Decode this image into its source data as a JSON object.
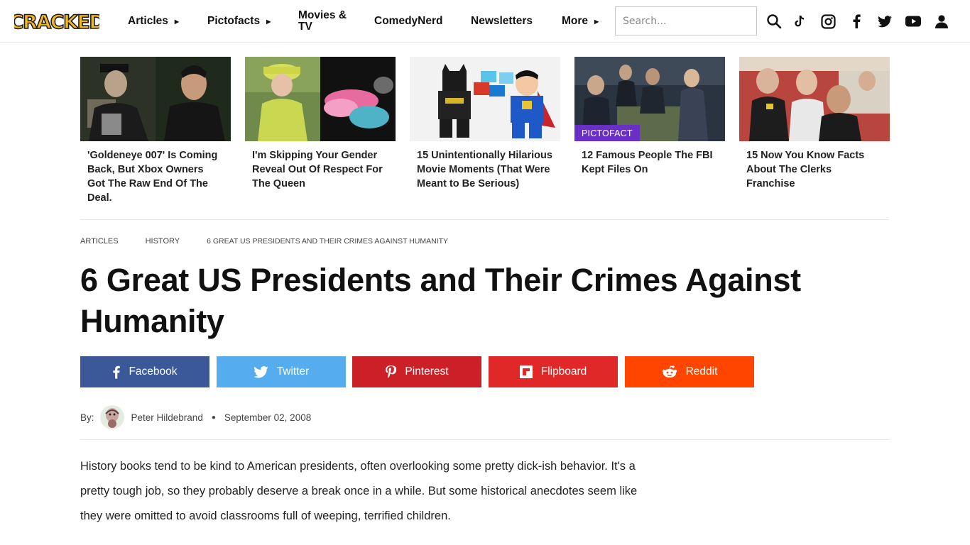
{
  "header": {
    "logo_text": "CRACKED",
    "nav": [
      {
        "label": "Articles",
        "has_caret": true
      },
      {
        "label": "Pictofacts",
        "has_caret": true
      },
      {
        "label": "Movies & TV",
        "has_caret": false
      },
      {
        "label": "ComedyNerd",
        "has_caret": false
      },
      {
        "label": "Newsletters",
        "has_caret": false
      },
      {
        "label": "More",
        "has_caret": true
      }
    ],
    "search_placeholder": "Search...",
    "icons": [
      "search-icon",
      "tiktok-icon",
      "instagram-icon",
      "facebook-icon",
      "twitter-icon",
      "youtube-icon",
      "user-icon"
    ]
  },
  "trending": [
    {
      "title": "'Goldeneye 007' Is Coming Back, But Xbox Owners Got The Raw End Of The Deal.",
      "badge": ""
    },
    {
      "title": "I'm Skipping Your Gender Reveal Out Of Respect For The Queen",
      "badge": ""
    },
    {
      "title": "15 Unintentionally Hilarious Movie Moments (That Were Meant to Be Serious)",
      "badge": ""
    },
    {
      "title": "12 Famous People The FBI Kept Files On",
      "badge": "PICTOFACT"
    },
    {
      "title": "15 Now You Know Facts About The Clerks Franchise",
      "badge": ""
    }
  ],
  "breadcrumb": [
    "ARTICLES",
    "HISTORY",
    "6 GREAT US PRESIDENTS AND THEIR CRIMES AGAINST HUMANITY"
  ],
  "article": {
    "title": "6 Great US Presidents and Their Crimes Against Humanity",
    "share": [
      {
        "label": "Facebook",
        "color": "#3b5998"
      },
      {
        "label": "Twitter",
        "color": "#55acee"
      },
      {
        "label": "Pinterest",
        "color": "#cb2027"
      },
      {
        "label": "Flipboard",
        "color": "#e12828"
      },
      {
        "label": "Reddit",
        "color": "#ff4500"
      }
    ],
    "byline": {
      "prefix": "By:",
      "author": "Peter Hildebrand",
      "date": "September 02, 2008"
    },
    "intro": "History books tend to be kind to American presidents, often overlooking some pretty dick-ish behavior. It's a pretty tough job, so they probably deserve a break once in a while. But some historical anecdotes seem like they were omitted to avoid classrooms full of weeping, terrified children."
  },
  "colors": {
    "logo_fill": "#f5b91c",
    "logo_stroke": "#1a1a1a",
    "badge": "#6a2fc7",
    "divider": "#e6e6e6"
  }
}
